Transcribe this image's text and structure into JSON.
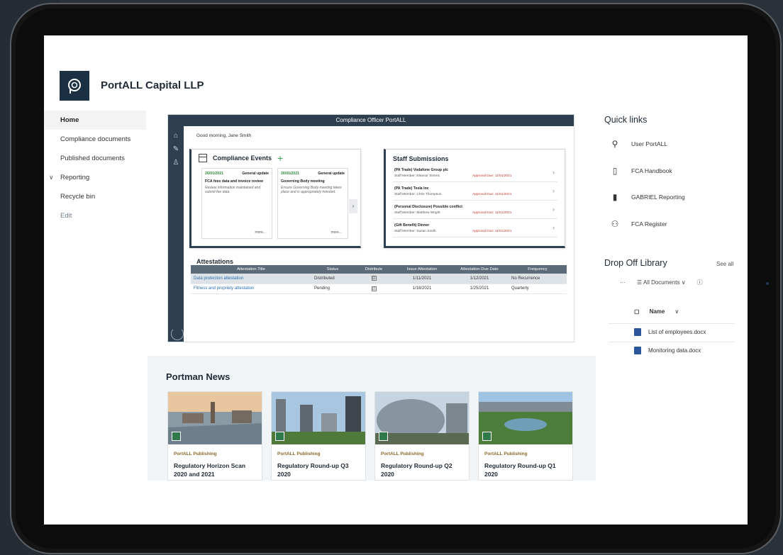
{
  "site": {
    "title": "PortALL Capital LLP"
  },
  "nav": {
    "items": [
      {
        "label": "Home",
        "active": true
      },
      {
        "label": "Compliance documents"
      },
      {
        "label": "Published documents"
      },
      {
        "label": "Reporting",
        "expandable": true
      },
      {
        "label": "Recycle bin"
      }
    ],
    "edit_label": "Edit"
  },
  "portal": {
    "bar_title": "Compliance Officer PortALL",
    "greeting": "Good morning, Jane Smith",
    "events_title": "Compliance Events",
    "events": [
      {
        "date": "26/01/2021",
        "type": "General update",
        "title": "FCA fees data and invoice review",
        "desc": "Review information maintained and submit fee data.",
        "more": "more..."
      },
      {
        "date": "26/01/2021",
        "type": "General update",
        "title": "Governing Body meeting",
        "desc": "Ensure Governing Body meeting takes place and is appropriately minuted.",
        "more": "more..."
      }
    ],
    "submissions_title": "Staff Submissions",
    "submissions": [
      {
        "title": "(PA Trade) Vodafone Group plc",
        "member": "Staff Member: Eleanor Simms",
        "approval": "Approval Due: 11/01/2021"
      },
      {
        "title": "(PA Trade) Tesla Inc",
        "member": "Staff Member: Chris Thompson",
        "approval": "Approval Due: 11/01/2021"
      },
      {
        "title": "(Personal Disclosure) Possible conflict",
        "member": "Staff Member: Matthew Wright",
        "approval": "Approval Due: 11/01/2021"
      },
      {
        "title": "(Gift Benefit) Dinner",
        "member": "Staff Member: Susan Smith",
        "approval": "Approval Due: 11/01/2021"
      }
    ],
    "attestations_title": "Attestations",
    "attestations_columns": [
      "Attestation Title",
      "Status",
      "Distribute",
      "Issue Attestation",
      "Attestation Due Date",
      "Frequency"
    ],
    "attestations_rows": [
      {
        "title": "Data protection attestation",
        "status": "Distributed",
        "distribute": "☑",
        "issue": "1/11/2021",
        "due": "1/12/2021",
        "frequency": "No Recurrence"
      },
      {
        "title": "Fitness and propriety attestation",
        "status": "Pending",
        "distribute": "☑",
        "issue": "1/18/2021",
        "due": "1/25/2021",
        "frequency": "Quarterly"
      }
    ]
  },
  "news": {
    "title": "Portman News",
    "items": [
      {
        "publisher": "PortALL Publishing",
        "headline": "Regulatory Horizon Scan 2020 and 2021"
      },
      {
        "publisher": "PortALL Publishing",
        "headline": "Regulatory Round-up Q3 2020"
      },
      {
        "publisher": "PortALL Publishing",
        "headline": "Regulatory Round-up Q2 2020"
      },
      {
        "publisher": "PortALL Publishing",
        "headline": "Regulatory Round-up Q1 2020"
      }
    ]
  },
  "quick_links": {
    "title": "Quick links",
    "items": [
      {
        "label": "User PortALL",
        "icon": "user-arrow-icon"
      },
      {
        "label": "FCA Handbook",
        "icon": "document-search-icon"
      },
      {
        "label": "GABRIEL Reporting",
        "icon": "bar-chart-icon"
      },
      {
        "label": "FCA Register",
        "icon": "people-list-icon"
      }
    ]
  },
  "drop_off": {
    "title": "Drop Off Library",
    "see_all": "See all",
    "more": "···",
    "view": "All Documents",
    "name_header": "Name",
    "files": [
      "List of employees.docx",
      "Monitoring data.docx"
    ]
  },
  "colors": {
    "brand": "#1c3043",
    "portal_bar": "#2e3f50",
    "accent_green": "#2f8a3b",
    "approval_red": "#c0392b"
  }
}
